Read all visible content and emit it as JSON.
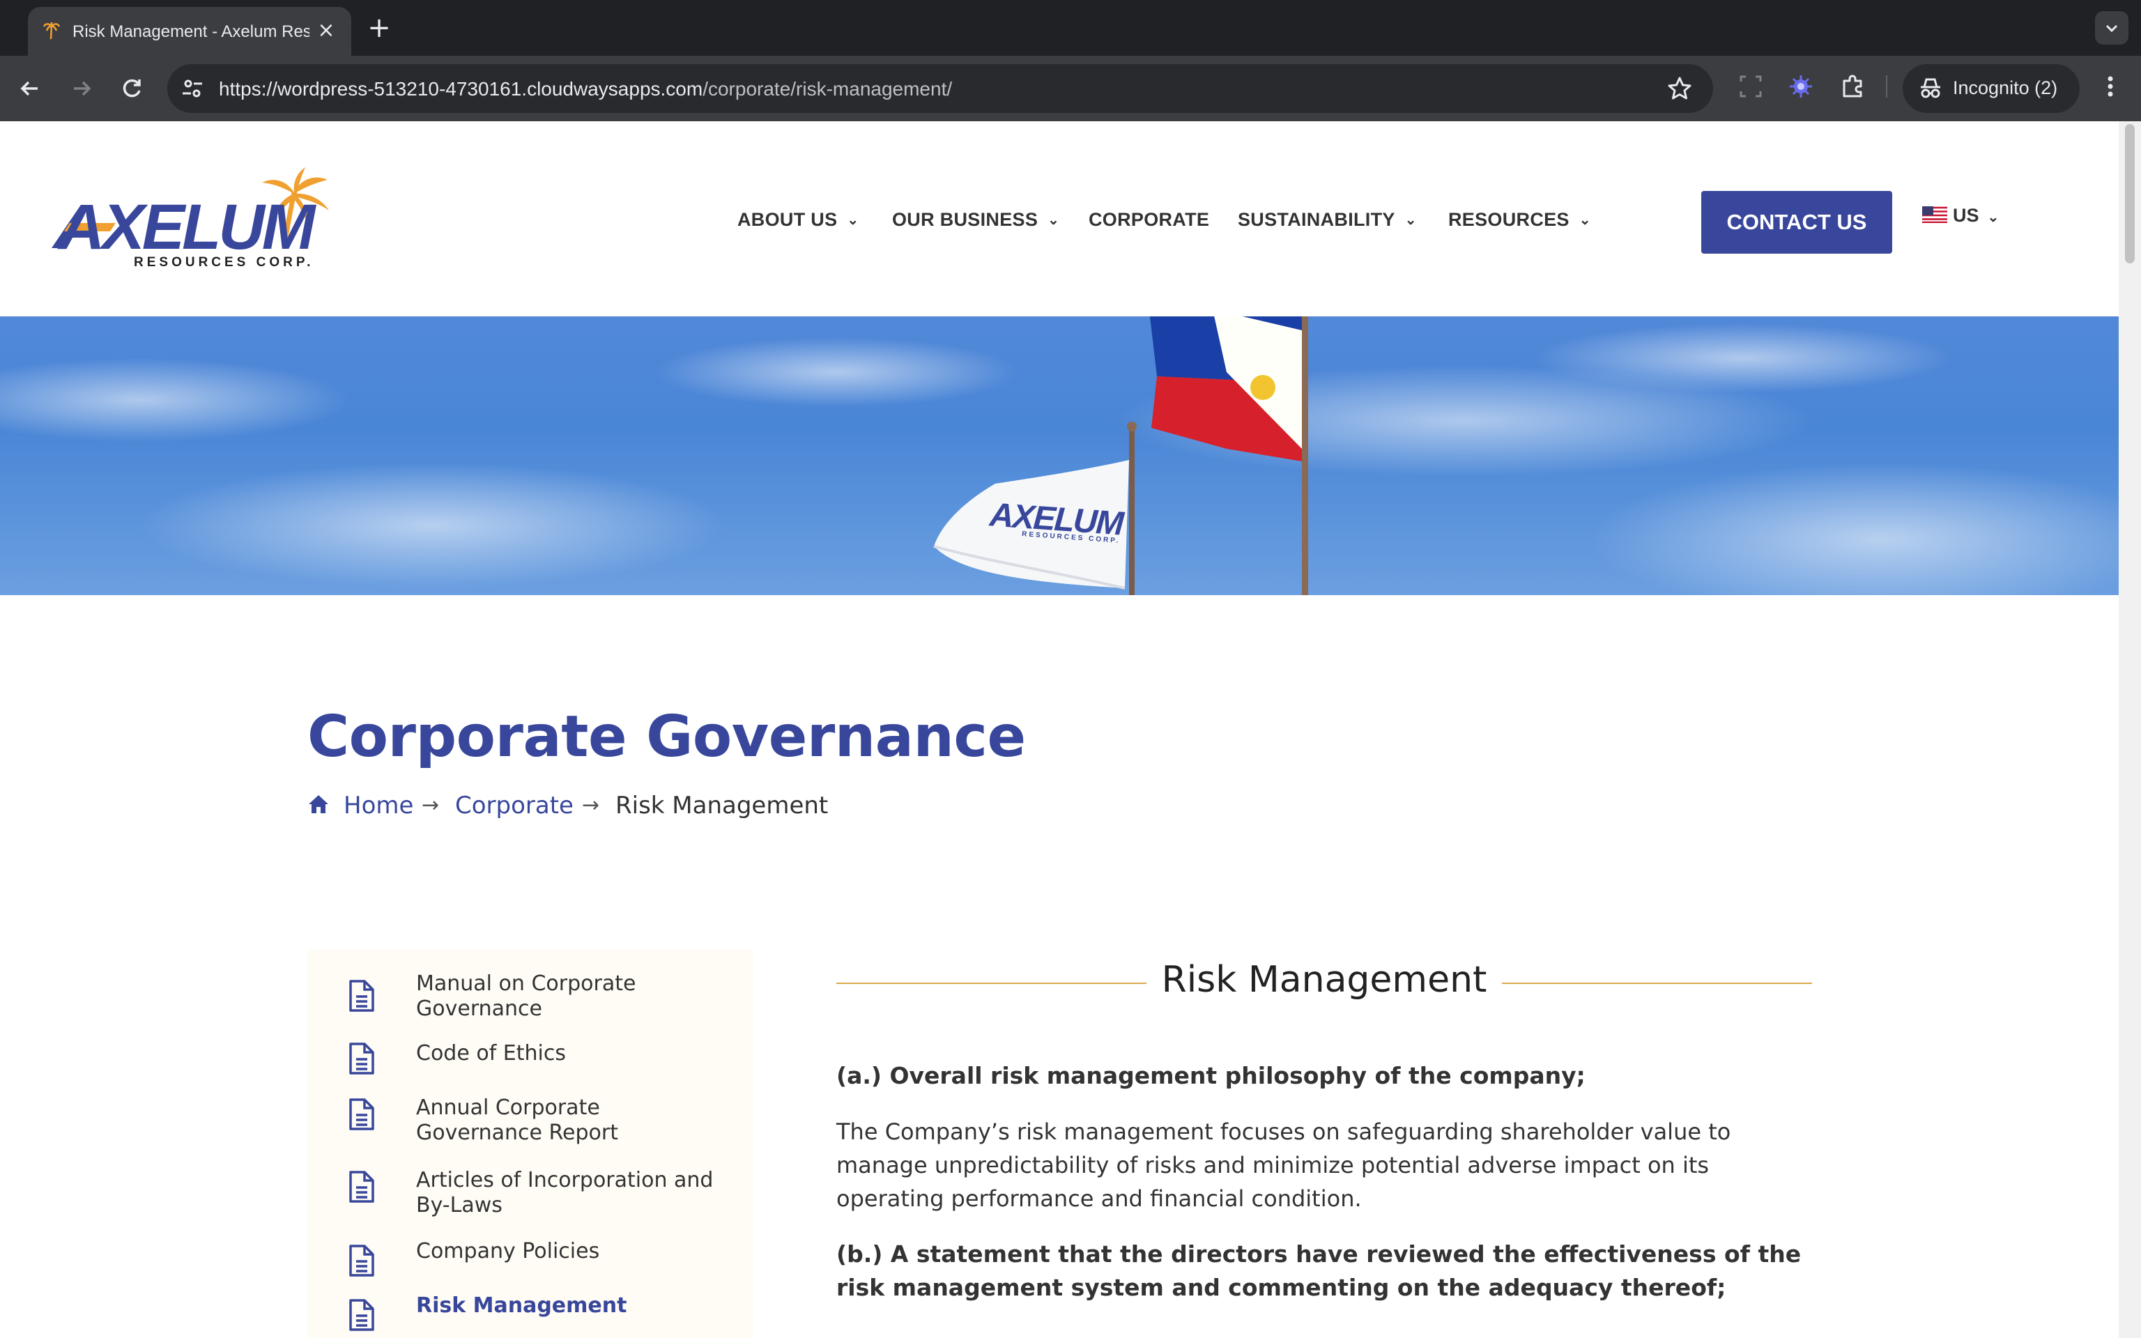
{
  "browser": {
    "tab_title": "Risk Management - Axelum Resources Corp.",
    "url_host": "https://wordpress-513210-4730161.cloudwaysapps.com",
    "url_path": "/corporate/risk-management/",
    "incognito_label": "Incognito (2)"
  },
  "header": {
    "logo_wordmark": "AXELUM",
    "logo_subtitle": "RESOURCES CORP.",
    "nav": [
      {
        "label": "ABOUT US",
        "has_dropdown": true
      },
      {
        "label": "OUR BUSINESS",
        "has_dropdown": true
      },
      {
        "label": "CORPORATE",
        "has_dropdown": false
      },
      {
        "label": "SUSTAINABILITY",
        "has_dropdown": true
      },
      {
        "label": "RESOURCES",
        "has_dropdown": true
      }
    ],
    "contact_label": "CONTACT US",
    "language": "US"
  },
  "hero": {
    "flag_logo_text": "AXELUM",
    "flag_logo_subtitle": "RESOURCES CORP."
  },
  "page": {
    "title": "Corporate Governance",
    "breadcrumb": {
      "home": "Home",
      "parent": "Corporate",
      "current": "Risk Management",
      "separator": "→"
    }
  },
  "sidebar": {
    "items": [
      {
        "label": "Manual on Corporate Governance",
        "active": false
      },
      {
        "label": "Code of Ethics",
        "active": false
      },
      {
        "label": "Annual Corporate Governance Report",
        "active": false
      },
      {
        "label": "Articles of Incorporation and By-Laws",
        "active": false
      },
      {
        "label": "Company Policies",
        "active": false
      },
      {
        "label": "Risk Management",
        "active": true
      }
    ]
  },
  "content": {
    "heading": "Risk Management",
    "q_a": "(a.) Overall risk management philosophy of the company;",
    "p_a": "The Company’s risk management focuses on safeguarding shareholder value to manage unpredictability of risks and minimize potential adverse impact on its operating performance and financial condition.",
    "q_b": "(b.) A statement that the directors have reviewed the effectiveness of the risk management system and commenting on the adequacy thereof;"
  },
  "colors": {
    "brand_blue": "#38479b",
    "brand_orange": "#f0a030",
    "divider_gold": "#d9a74a",
    "sidebar_bg": "#fffcf5",
    "hero_sky": "#4a86d6"
  },
  "icons": {
    "favicon": "axelum-palm-icon",
    "home": "home-icon",
    "document": "document-icon",
    "star": "bookmark-star-icon",
    "extensions": "puzzle-icon",
    "incognito": "incognito-icon"
  }
}
